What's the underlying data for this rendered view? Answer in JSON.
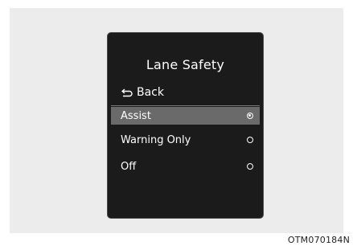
{
  "screen": {
    "title": "Lane Safety",
    "back_label": "Back",
    "options": [
      {
        "label": "Assist",
        "selected": true
      },
      {
        "label": "Warning Only",
        "selected": false
      },
      {
        "label": "Off",
        "selected": false
      }
    ]
  },
  "figure_code": "OTM070184N",
  "colors": {
    "background": "#ececec",
    "screen": "#1b1b1b",
    "highlight": "#6a6a6a",
    "text": "#ffffff"
  },
  "icons": {
    "back": "back-arrow-icon",
    "radio_on": "radio-selected-icon",
    "radio_off": "radio-unselected-icon"
  }
}
